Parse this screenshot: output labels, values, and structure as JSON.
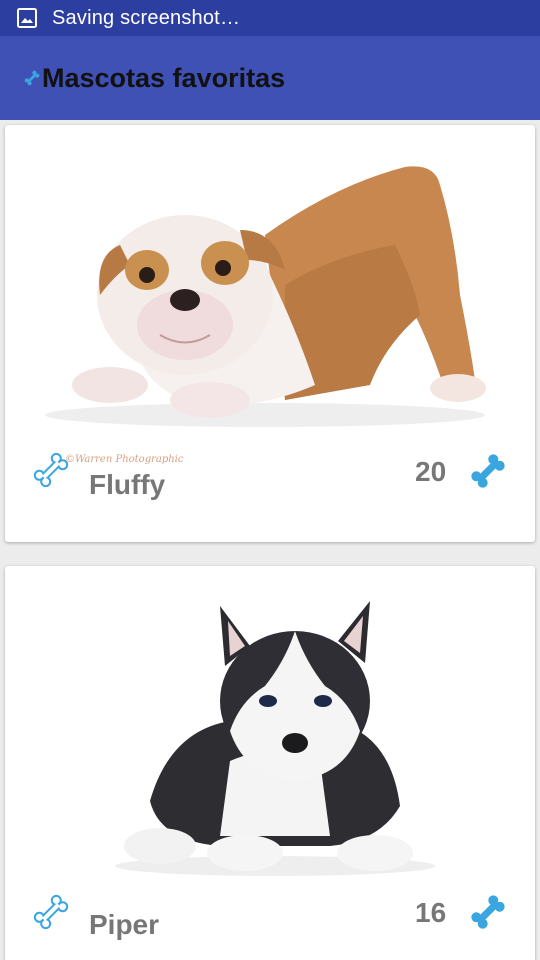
{
  "status_bar": {
    "text": "Saving screenshot…",
    "icon": "image-icon"
  },
  "app_bar": {
    "title": "Mascotas favoritas",
    "icon": "bone-icon",
    "color": "#3f51b5"
  },
  "pets": [
    {
      "name": "Fluffy",
      "likes": "20",
      "watermark": "©Warren Photographic",
      "photo": "bulldog-puppy"
    },
    {
      "name": "Piper",
      "likes": "16",
      "photo": "husky-puppy"
    }
  ],
  "colors": {
    "status_bar": "#2c3ea0",
    "accent_bone": "#3aa6e0",
    "text_gray": "#777777"
  }
}
